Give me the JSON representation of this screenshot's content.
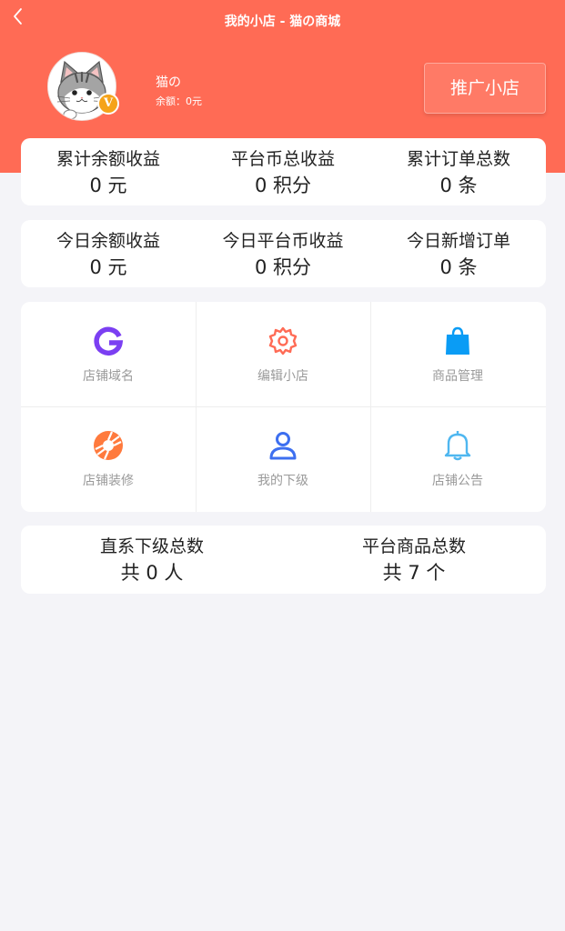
{
  "header": {
    "title": "我的小店 - 猫の商城",
    "user_name": "猫の",
    "balance_text": "余额：0元",
    "vip_badge": "V",
    "promote_button": "推广小店"
  },
  "stats_total": [
    {
      "label": "累计余额收益",
      "value": "0 元"
    },
    {
      "label": "平台币总收益",
      "value": "0 积分"
    },
    {
      "label": "累计订单总数",
      "value": "0 条"
    }
  ],
  "stats_today": [
    {
      "label": "今日余额收益",
      "value": "0 元"
    },
    {
      "label": "今日平台币收益",
      "value": "0 积分"
    },
    {
      "label": "今日新增订单",
      "value": "0 条"
    }
  ],
  "menu": [
    {
      "label": "店铺域名",
      "icon": "g-logo-icon",
      "color": "#7b3ff2"
    },
    {
      "label": "编辑小店",
      "icon": "gear-icon",
      "color": "#ff6b55"
    },
    {
      "label": "商品管理",
      "icon": "shopping-bag-icon",
      "color": "#0a9cf5"
    },
    {
      "label": "店铺装修",
      "icon": "aperture-icon",
      "color": "#ff7a3d"
    },
    {
      "label": "我的下级",
      "icon": "user-icon",
      "color": "#3d6ff0"
    },
    {
      "label": "店铺公告",
      "icon": "bell-icon",
      "color": "#4fb7f0"
    }
  ],
  "bottom_stats": [
    {
      "label": "直系下级总数",
      "value": "共 0 人"
    },
    {
      "label": "平台商品总数",
      "value": "共 7 个"
    }
  ]
}
